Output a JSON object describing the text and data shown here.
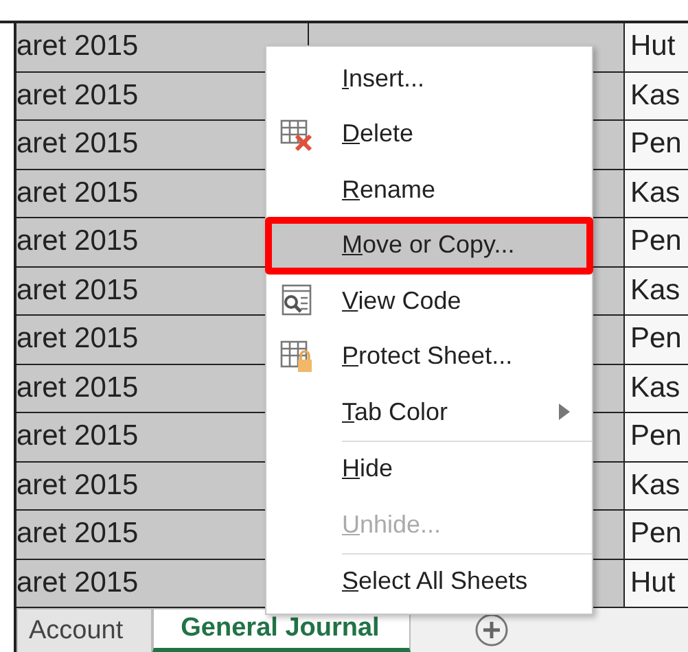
{
  "grid": {
    "rows": [
      {
        "column_1": "aret 2015",
        "column_3": "Hut"
      },
      {
        "column_1": "aret 2015",
        "column_3": "Kas"
      },
      {
        "column_1": "aret 2015",
        "column_3": "Pen"
      },
      {
        "column_1": "aret 2015",
        "column_3": "Kas"
      },
      {
        "column_1": "aret 2015",
        "column_3": "Pen"
      },
      {
        "column_1": "aret 2015",
        "column_3": "Kas"
      },
      {
        "column_1": "aret 2015",
        "column_3": "Pen"
      },
      {
        "column_1": "aret 2015",
        "column_3": "Kas"
      },
      {
        "column_1": "aret 2015",
        "column_3": "Pen"
      },
      {
        "column_1": "aret 2015",
        "column_3": "Kas"
      },
      {
        "column_1": "aret 2015",
        "column_3": "Pen"
      },
      {
        "column_1": "aret 2015",
        "column_3": "Hut"
      }
    ]
  },
  "context_menu": {
    "items": [
      {
        "kind": "plain",
        "label": "Insert...",
        "selected": false,
        "outlined": false,
        "disabled": false
      },
      {
        "kind": "delete",
        "label": "Delete",
        "selected": false,
        "outlined": false,
        "disabled": false
      },
      {
        "kind": "plain",
        "label": "Rename",
        "selected": false,
        "outlined": false,
        "disabled": false
      },
      {
        "kind": "plain",
        "label": "Move or Copy...",
        "selected": true,
        "outlined": true,
        "disabled": false
      },
      {
        "kind": "code",
        "label": "View Code",
        "selected": false,
        "outlined": false,
        "disabled": false
      },
      {
        "kind": "protect",
        "label": "Protect Sheet...",
        "selected": false,
        "outlined": false,
        "disabled": false
      },
      {
        "kind": "submenu",
        "label": "Tab Color",
        "selected": false,
        "outlined": false,
        "disabled": false
      },
      {
        "kind": "separator"
      },
      {
        "kind": "plain",
        "label": "Hide",
        "selected": false,
        "outlined": false,
        "disabled": false
      },
      {
        "kind": "plain",
        "label": "Unhide...",
        "selected": false,
        "outlined": false,
        "disabled": true
      },
      {
        "kind": "separator"
      },
      {
        "kind": "plain",
        "label": "Select All Sheets",
        "selected": false,
        "outlined": false,
        "disabled": false
      }
    ]
  },
  "sheet_tabs": [
    {
      "label": "Account",
      "selected": false
    },
    {
      "label": "General Journal",
      "selected": true
    }
  ]
}
